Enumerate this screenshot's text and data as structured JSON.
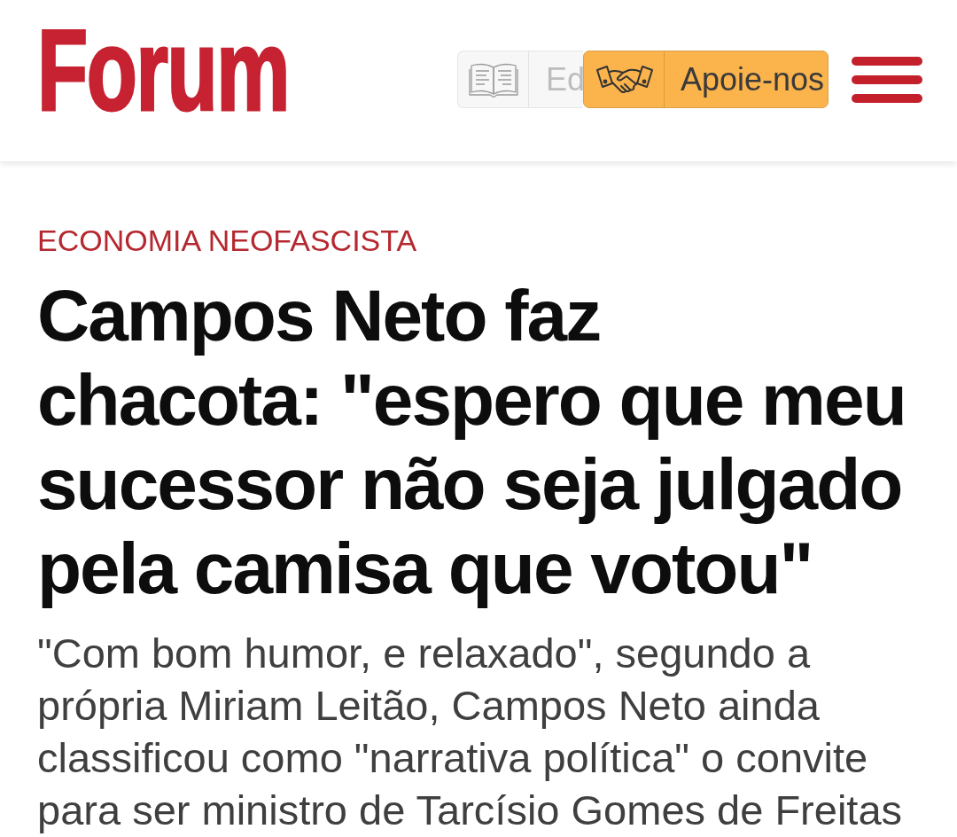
{
  "header": {
    "logo": "Forum",
    "book_button": {
      "label": "Ed"
    },
    "support_button": {
      "label": "Apoie-nos"
    }
  },
  "article": {
    "category": "ECONOMIA NEOFASCISTA",
    "headline": "Campos Neto faz\nchacota: \"espero que meu\nsucessor não seja julgado\npela camisa que votou\"",
    "lede": "\"Com bom humor, e relaxado\", segundo a\nprópria Miriam Leitão, Campos Neto ainda\nclassificou como \"narrativa política\" o convite\npara ser ministro de Tarcísio Gomes de Freitas"
  }
}
